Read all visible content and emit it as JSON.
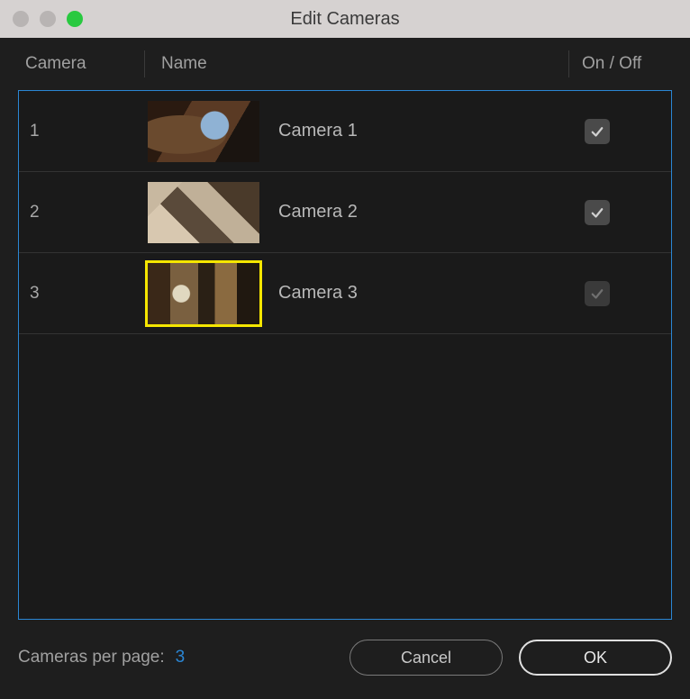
{
  "window": {
    "title": "Edit Cameras"
  },
  "columns": {
    "camera": "Camera",
    "name": "Name",
    "onoff": "On / Off"
  },
  "rows": [
    {
      "index": "1",
      "name": "Camera 1",
      "checked": true,
      "disabled": false,
      "selected": false,
      "thumbClass": "t1"
    },
    {
      "index": "2",
      "name": "Camera 2",
      "checked": true,
      "disabled": false,
      "selected": false,
      "thumbClass": "t2"
    },
    {
      "index": "3",
      "name": "Camera 3",
      "checked": true,
      "disabled": true,
      "selected": true,
      "thumbClass": "t3"
    }
  ],
  "footer": {
    "label": "Cameras per page:",
    "value": "3",
    "cancel": "Cancel",
    "ok": "OK"
  }
}
